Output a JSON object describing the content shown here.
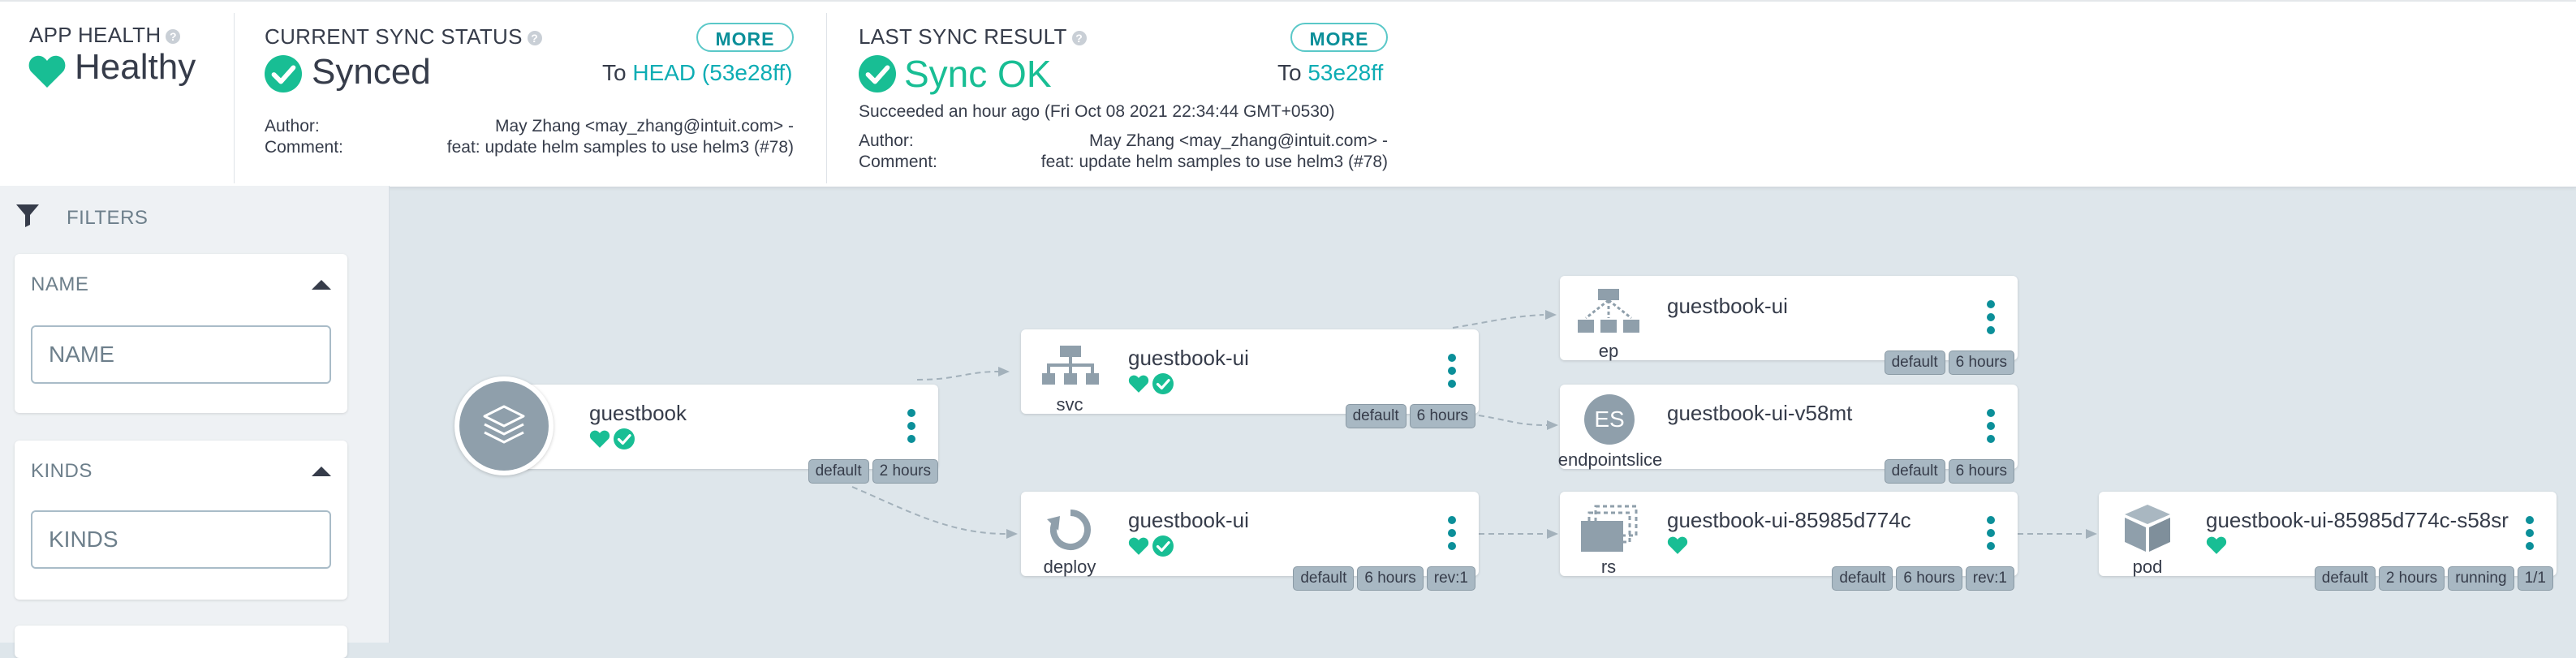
{
  "app_health": {
    "label": "APP HEALTH",
    "status": "Healthy"
  },
  "sync_status": {
    "label": "CURRENT SYNC STATUS",
    "status": "Synced",
    "more_label": "MORE",
    "to_label": "To",
    "to_value": "HEAD (53e28ff)",
    "author_label": "Author:",
    "author": "May Zhang <may_zhang@intuit.com> -",
    "comment_label": "Comment:",
    "comment": "feat: update helm samples to use helm3 (#78)"
  },
  "sync_result": {
    "label": "LAST SYNC RESULT",
    "status": "Sync OK",
    "more_label": "MORE",
    "to_label": "To",
    "to_value": "53e28ff",
    "succeeded": "Succeeded an hour ago (Fri Oct 08 2021 22:34:44 GMT+0530)",
    "author_label": "Author:",
    "author": "May Zhang <may_zhang@intuit.com> -",
    "comment_label": "Comment:",
    "comment": "feat: update helm samples to use helm3 (#78)"
  },
  "filters": {
    "title": "FILTERS",
    "name": {
      "title": "NAME",
      "placeholder": "NAME"
    },
    "kinds": {
      "title": "KINDS",
      "placeholder": "KINDS"
    }
  },
  "nodes": {
    "app": {
      "name": "guestbook",
      "tags": [
        "default",
        "2 hours"
      ]
    },
    "svc": {
      "name": "guestbook-ui",
      "kind": "svc",
      "tags": [
        "default",
        "6 hours"
      ]
    },
    "deploy": {
      "name": "guestbook-ui",
      "kind": "deploy",
      "tags": [
        "default",
        "6 hours",
        "rev:1"
      ]
    },
    "ep": {
      "name": "guestbook-ui",
      "kind": "ep",
      "tags": [
        "default",
        "6 hours"
      ]
    },
    "es": {
      "name": "guestbook-ui-v58mt",
      "kind": "endpointslice",
      "icon_text": "ES",
      "tags": [
        "default",
        "6 hours"
      ]
    },
    "rs": {
      "name": "guestbook-ui-85985d774c",
      "kind": "rs",
      "tags": [
        "default",
        "6 hours",
        "rev:1"
      ]
    },
    "pod": {
      "name": "guestbook-ui-85985d774c-s58sr",
      "kind": "pod",
      "tags": [
        "default",
        "2 hours",
        "running",
        "1/1"
      ]
    }
  },
  "colors": {
    "healthy": "#18be94",
    "accent": "#0dadb4",
    "tag_bg": "#a8b8c3",
    "canvas": "#dee6eb"
  }
}
